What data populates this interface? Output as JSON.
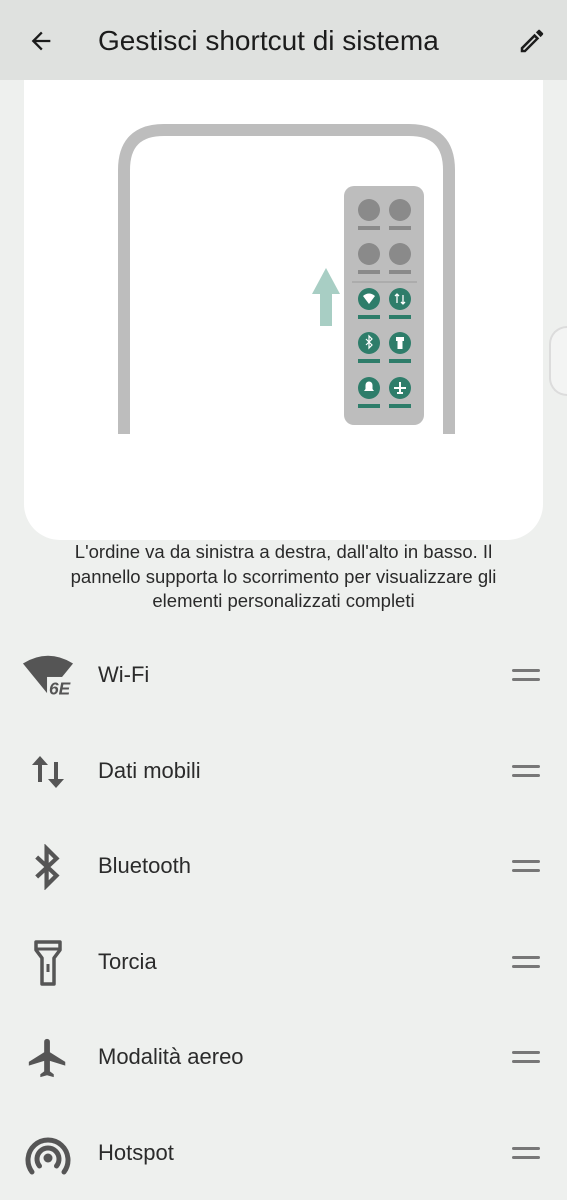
{
  "header": {
    "title": "Gestisci shortcut di sistema"
  },
  "description": "L'ordine va da sinistra a destra, dall'alto in basso. Il pannello supporta lo scorrimento per visualizzare gli elementi personalizzati completi",
  "shortcuts": [
    {
      "label": "Wi-Fi",
      "icon": "wifi-6e-icon"
    },
    {
      "label": "Dati mobili",
      "icon": "mobile-data-icon"
    },
    {
      "label": "Bluetooth",
      "icon": "bluetooth-icon"
    },
    {
      "label": "Torcia",
      "icon": "flashlight-icon"
    },
    {
      "label": "Modalità aereo",
      "icon": "airplane-icon"
    },
    {
      "label": "Hotspot",
      "icon": "hotspot-icon"
    }
  ],
  "colors": {
    "accent": "#2e7d6a",
    "topbar": "#dfe1df",
    "background": "#eef0ee"
  }
}
